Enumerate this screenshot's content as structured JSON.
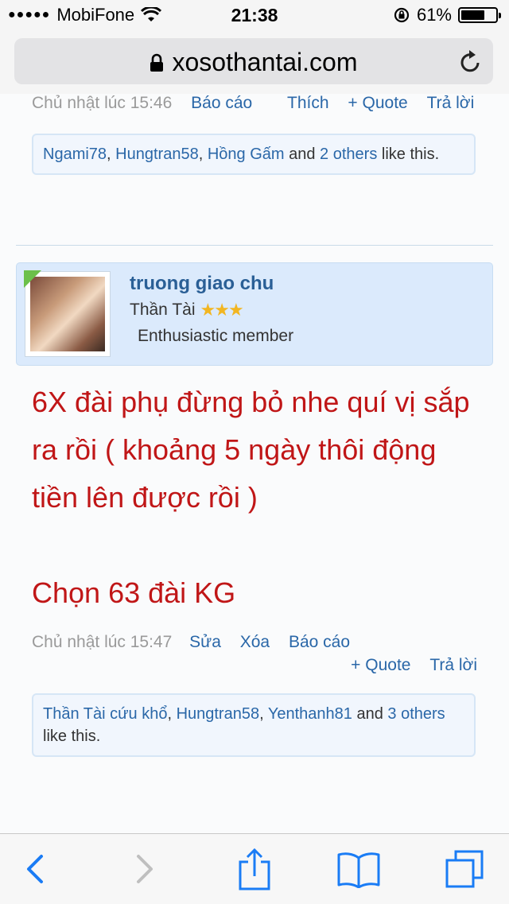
{
  "status": {
    "signal": "●●●●●",
    "carrier": "MobiFone",
    "time": "21:38",
    "battery": "61%",
    "battery_level": 0.61
  },
  "browser": {
    "url": "xosothantai.com"
  },
  "prev_post": {
    "timestamp": "Chủ nhật lúc 15:46",
    "report": "Báo cáo",
    "like": "Thích",
    "quote": "+ Quote",
    "reply": "Trả lời",
    "likes": {
      "user1": "Ngami78",
      "user2": "Hungtran58",
      "user3": "Hồng Gấm",
      "and": "and",
      "others": "2 others",
      "suffix": "like this."
    }
  },
  "post": {
    "author": "truong giao chu",
    "rank": "Thần Tài",
    "stars": "★★★",
    "role": "Enthusiastic member",
    "body_line1": "6X đài phụ đừng bỏ nhe quí vị sắp ra rồi ( khoảng 5 ngày thôi động tiền lên được rồi )",
    "body_line2": "Chọn 63 đài KG",
    "timestamp": "Chủ nhật lúc 15:47",
    "edit": "Sửa",
    "delete": "Xóa",
    "report": "Báo cáo",
    "quote": "+ Quote",
    "reply": "Trả lời",
    "likes": {
      "user1": "Thần Tài cứu khổ",
      "user2": "Hungtran58",
      "user3": "Yenthanh81",
      "and": "and",
      "others": "3 others",
      "suffix": "like this."
    }
  },
  "toolbar": {
    "back": "back-icon",
    "forward": "forward-icon",
    "share": "share-icon",
    "bookmarks": "bookmarks-icon",
    "tabs": "tabs-icon"
  },
  "colors": {
    "accent": "#1a7cf5",
    "link": "#2a67a8",
    "post_text": "#c01617"
  }
}
